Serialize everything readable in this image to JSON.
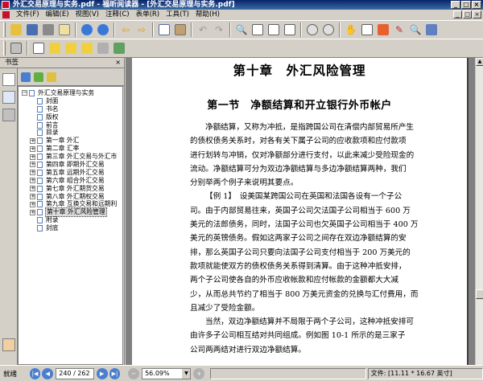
{
  "window": {
    "title": "外汇交易原理与实务.pdf - 福昕阅读器 - [外汇交易原理与实务.pdf]",
    "min_glyph": "_",
    "max_glyph": "□",
    "close_glyph": "×"
  },
  "menu": [
    "文件(F)",
    "编辑(E)",
    "视图(V)",
    "注释(C)",
    "表单(R)",
    "工具(T)",
    "帮助(H)"
  ],
  "toolbar1_icons": [
    "open-icon",
    "save-icon",
    "print-icon",
    "email-icon",
    "prev-page-icon",
    "next-page-icon",
    "back-icon",
    "forward-icon",
    "copy-icon",
    "paste-icon",
    "undo-icon",
    "redo-icon",
    "zoom-icon",
    "single-page-icon",
    "continuous-icon",
    "facing-icon",
    "zoom-out-icon",
    "zoom-in-icon",
    "hand-icon",
    "select-text-icon",
    "snapshot-icon",
    "pen-icon",
    "find-icon",
    "fit-icon"
  ],
  "sidebar": {
    "title": "书签",
    "close_glyph": "×",
    "bookmarks": [
      {
        "label": "外汇交易原理与实务",
        "level": 0,
        "expandable": true
      },
      {
        "label": "封面",
        "level": 1
      },
      {
        "label": "书名",
        "level": 1
      },
      {
        "label": "版权",
        "level": 1
      },
      {
        "label": "前言",
        "level": 1
      },
      {
        "label": "目录",
        "level": 1
      },
      {
        "label": "第一章 外汇",
        "level": 1,
        "expandable": true
      },
      {
        "label": "第二章 汇率",
        "level": 1,
        "expandable": true
      },
      {
        "label": "第三章 外汇交易与外汇市",
        "level": 1,
        "expandable": true
      },
      {
        "label": "第四章 即期外汇交易",
        "level": 1,
        "expandable": true
      },
      {
        "label": "第五章 远期外汇交易",
        "level": 1,
        "expandable": true
      },
      {
        "label": "第六章 组合外汇交易",
        "level": 1,
        "expandable": true
      },
      {
        "label": "第七章 外汇期货交易",
        "level": 1,
        "expandable": true
      },
      {
        "label": "第八章 外汇期权交易",
        "level": 1,
        "expandable": true
      },
      {
        "label": "第九章 互换交易和远期利",
        "level": 1,
        "expandable": true
      },
      {
        "label": "第十章 外汇风险管理",
        "level": 1,
        "expandable": true,
        "selected": true
      },
      {
        "label": "附录",
        "level": 1
      },
      {
        "label": "封底",
        "level": 1
      }
    ]
  },
  "document": {
    "chapter_title": "第十章　外汇风险管理",
    "section_title": "第一节　净额结算和开立银行外币帐户",
    "lines": [
      {
        "text": "净额结算，又称为冲抵，是指跨国公司在清偿内部贸易所产生",
        "indent": true
      },
      {
        "text": "的债权债务关系时，对各有关下属子公司的应收款项和应付款项",
        "indent": false
      },
      {
        "text": "进行划转与冲销，仅对净额部分进行支付，以此来减少受险现金的",
        "indent": false
      },
      {
        "text": "流动。净额结算可分为双边净额结算与多边净额结算两种，我们",
        "indent": false
      },
      {
        "text": "分别举两个例子来说明其要点。",
        "indent": false
      },
      {
        "text": "【例 1】　设美国某跨国公司在英国和法国各设有一个子公",
        "indent": true
      },
      {
        "text": "司。由于内部贸易往来，英国子公司欠法国子公司相当于 600 万",
        "indent": false
      },
      {
        "text": "美元的法郎债务，同时，法国子公司也欠英国子公司相当于 400 万",
        "indent": false
      },
      {
        "text": "美元的英镑债务。假如这两家子公司之间存在双边净额结算的安",
        "indent": false
      },
      {
        "text": "排，那么英国子公司只要向法国子公司支付相当于 200 万美元的",
        "indent": false
      },
      {
        "text": "款项就能使双方的债权债务关系得到清算。由于这种冲抵安排，",
        "indent": false
      },
      {
        "text": "两个子公司使各自的外币应收帐款和应付帐款的金额都大大减",
        "indent": false
      },
      {
        "text": "少，从而总共节约了相当于 800 万美元资金的兑换与汇付费用，而",
        "indent": false
      },
      {
        "text": "且减少了受险金额。",
        "indent": false
      },
      {
        "text": "当然，双边净额结算并不局限于两个子公司，这种冲抵安排可",
        "indent": true
      },
      {
        "text": "由许多子公司相互结对共同组成。例如图 10-1 所示的是三家子",
        "indent": false
      },
      {
        "text": "公司两两结对进行双边净额结算。",
        "indent": false
      }
    ]
  },
  "statusbar": {
    "left_text": "就绪",
    "page_field": "240 / 262",
    "zoom_field": "56.09%",
    "size_field": "文件: [11.11 * 16.67 英寸]",
    "nav_first": "|◀",
    "nav_prev": "◀",
    "nav_next": "▶",
    "nav_last": "▶|"
  }
}
